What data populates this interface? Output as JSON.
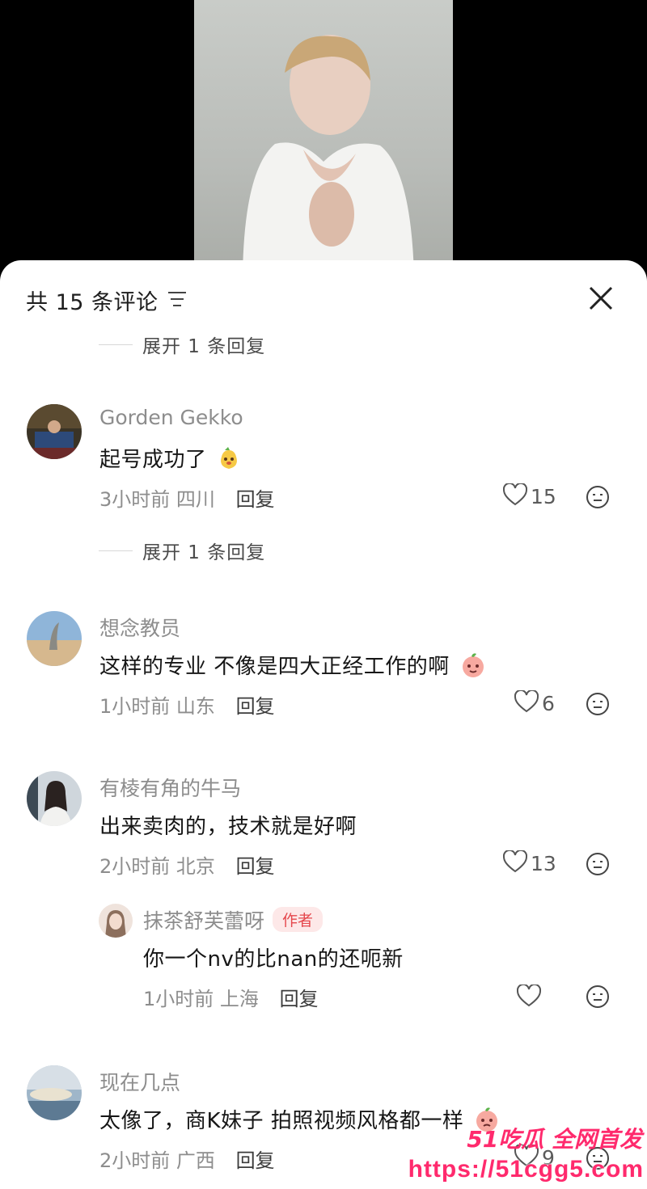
{
  "header": {
    "title": "共 15 条评论"
  },
  "expand_replies": [
    {
      "label": "展开 1 条回复"
    },
    {
      "label": "展开 1 条回复"
    }
  ],
  "comments": [
    {
      "username": "Gorden Gekko",
      "text": "起号成功了",
      "time": "3小时前",
      "location": "四川",
      "reply_label": "回复",
      "likes": "15"
    },
    {
      "username": "想念教员",
      "text": "这样的专业  不像是四大正经工作的啊",
      "time": "1小时前",
      "location": "山东",
      "reply_label": "回复",
      "likes": "6"
    },
    {
      "username": "有棱有角的牛马",
      "text": "出来卖肉的，技术就是好啊",
      "time": "2小时前",
      "location": "北京",
      "reply_label": "回复",
      "likes": "13"
    },
    {
      "username": "现在几点",
      "text": "太像了，商K妹子 拍照视频风格都一样",
      "time": "2小时前",
      "location": "广西",
      "reply_label": "回复",
      "likes": "9"
    }
  ],
  "reply": {
    "username": "抹茶舒芙蕾呀",
    "badge": "作者",
    "text": "你一个nv的比nan的还呃新",
    "time": "1小时前",
    "location": "上海",
    "reply_label": "回复"
  },
  "watermark": {
    "top": "51吃瓜 全网首发",
    "url": "https://51cgg5.com"
  },
  "icons": [
    "sort-icon",
    "close-icon",
    "heart-icon",
    "dislike-face-icon"
  ],
  "colors": {
    "badge": "#e5484d",
    "watermark": "#ff2a6d"
  }
}
